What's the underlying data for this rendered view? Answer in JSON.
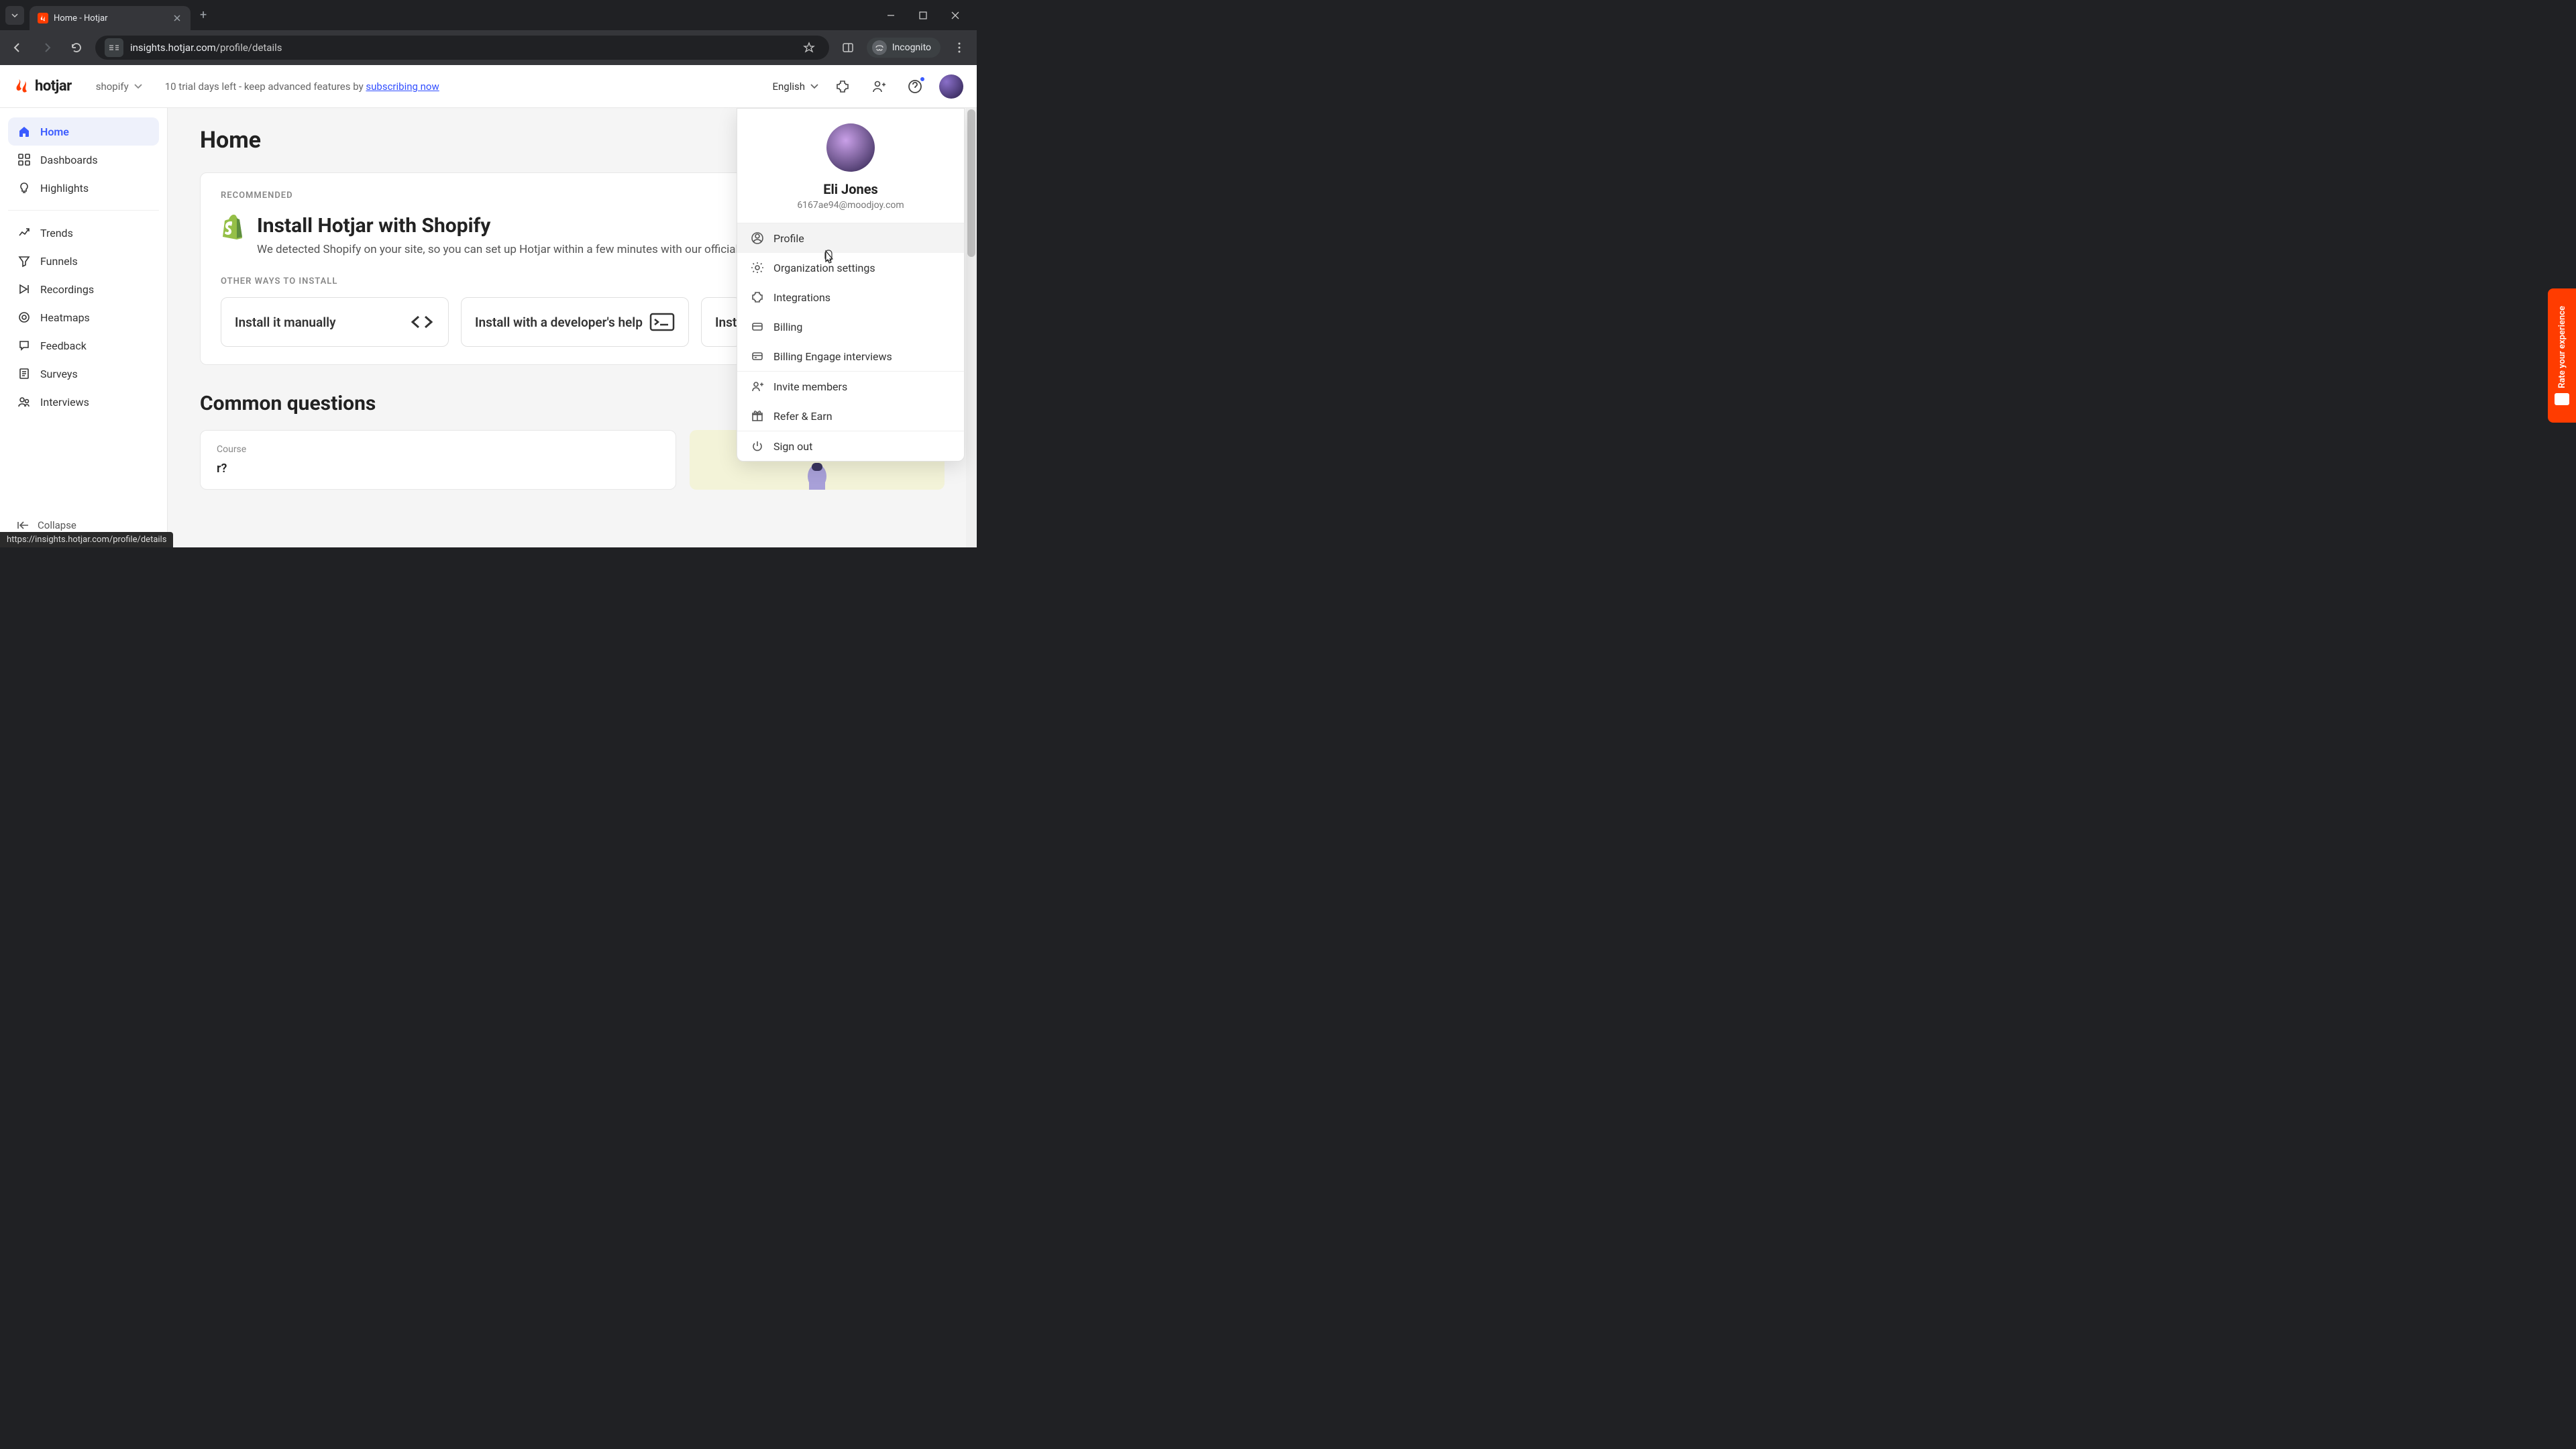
{
  "browser": {
    "tab_title": "Home - Hotjar",
    "url_host": "insights.hotjar.com",
    "url_path": "/profile/details",
    "incognito": "Incognito"
  },
  "header": {
    "logo": "hotjar",
    "org": "shopify",
    "trial_prefix": "10 trial days left - keep advanced features by ",
    "trial_link": "subscribing now",
    "language": "English"
  },
  "sidebar": {
    "items": [
      {
        "label": "Home",
        "active": true
      },
      {
        "label": "Dashboards"
      },
      {
        "label": "Highlights"
      },
      {
        "label": "Trends"
      },
      {
        "label": "Funnels"
      },
      {
        "label": "Recordings"
      },
      {
        "label": "Heatmaps"
      },
      {
        "label": "Feedback"
      },
      {
        "label": "Surveys"
      },
      {
        "label": "Interviews"
      }
    ],
    "collapse": "Collapse"
  },
  "main": {
    "title": "Home",
    "recommended": "RECOMMENDED",
    "install_title": "Install Hotjar with Shopify",
    "install_desc": "We detected Shopify on your site, so you can set up Hotjar within a few minutes with our official S",
    "other_ways": "OTHER WAYS TO INSTALL",
    "opts": [
      {
        "label": "Install it manually"
      },
      {
        "label": "Install with a developer's help"
      },
      {
        "label": "Inst"
      }
    ],
    "cq_title": "Common questions",
    "cq_tag": "Course",
    "cq_question_partial": "r?"
  },
  "menu": {
    "name": "Eli Jones",
    "email": "6167ae94@moodjoy.com",
    "items": [
      "Profile",
      "Organization settings",
      "Integrations",
      "Billing",
      "Billing Engage interviews",
      "Invite members",
      "Refer & Earn",
      "Sign out"
    ]
  },
  "feedback_tab": "Rate your experience",
  "status_url": "https://insights.hotjar.com/profile/details"
}
